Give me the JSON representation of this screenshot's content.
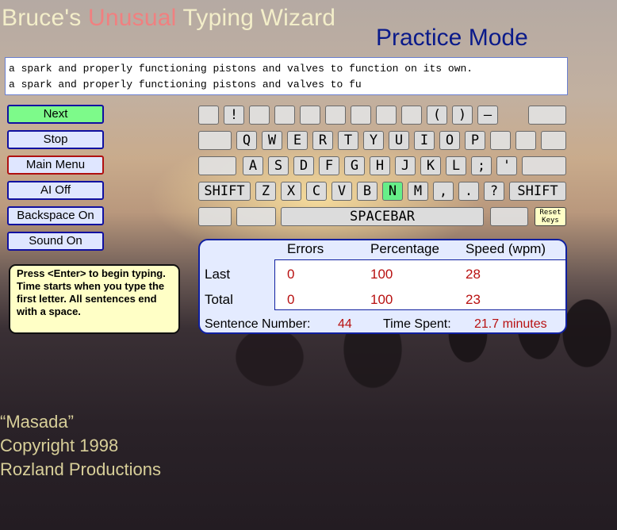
{
  "app": {
    "title_part1": "Bruce's ",
    "title_accent": "Unusual",
    "title_part2": " Typing Wizard",
    "mode": "Practice Mode"
  },
  "sentence": {
    "target": "a spark and properly functioning pistons and valves to function on its own.",
    "typed": "a spark and properly functioning pistons and valves to fu"
  },
  "menu": {
    "next": "Next",
    "stop": "Stop",
    "main_menu": "Main Menu",
    "ai": "AI Off",
    "backspace": "Backspace On",
    "sound": "Sound On"
  },
  "hint": "Press <Enter> to begin typing. Time starts when you type the first letter. All sentences end with a space.",
  "keyboard": {
    "row1": [
      "",
      "!",
      "",
      "",
      "",
      "",
      "",
      "",
      "",
      "(",
      ")",
      "–",
      ""
    ],
    "row2": [
      "Q",
      "W",
      "E",
      "R",
      "T",
      "Y",
      "U",
      "I",
      "O",
      "P",
      "",
      ""
    ],
    "row3": [
      "A",
      "S",
      "D",
      "F",
      "G",
      "H",
      "J",
      "K",
      "L",
      ";",
      "'"
    ],
    "shift": "SHIFT",
    "row4": [
      "Z",
      "X",
      "C",
      "V",
      "B",
      "N",
      "M",
      ",",
      ".",
      "?"
    ],
    "spacebar": "SPACEBAR",
    "reset_keys": "Reset Keys",
    "highlighted_key": "N",
    "highlight_color": "#66ee88"
  },
  "stats": {
    "col_errors": "Errors",
    "col_percentage": "Percentage",
    "col_speed": "Speed (wpm)",
    "row_last": "Last",
    "row_total": "Total",
    "last": {
      "errors": "0",
      "percentage": "100",
      "speed": "28"
    },
    "total": {
      "errors": "0",
      "percentage": "100",
      "speed": "23"
    },
    "sentence_number_label": "Sentence Number:",
    "sentence_number": "44",
    "time_spent_label": "Time Spent:",
    "time_spent": "21.7 minutes"
  },
  "credits": {
    "scene": "“Masada”",
    "copyright": "Copyright 1998",
    "company": "Rozland Productions"
  },
  "colors": {
    "title_accent": "#f08080",
    "mode": "#0a1a8a",
    "next_button": "#7dfa8a",
    "stat_value": "#b81010"
  }
}
